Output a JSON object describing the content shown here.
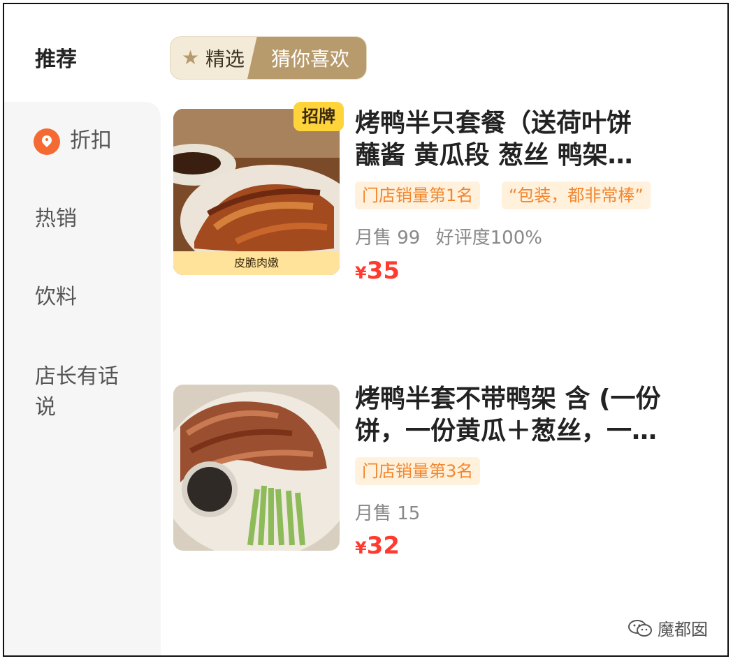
{
  "sidebar": {
    "items": [
      {
        "label": "推荐",
        "active": true,
        "icon": null
      },
      {
        "label": "折扣",
        "active": false,
        "icon": "discount-tag-icon"
      },
      {
        "label": "热销",
        "active": false,
        "icon": null
      },
      {
        "label": "饮料",
        "active": false,
        "icon": null
      },
      {
        "label": "店长有话说",
        "active": false,
        "icon": null
      }
    ]
  },
  "filter": {
    "left_label": "精选",
    "right_label": "猜你喜欢",
    "left_icon": "star-icon"
  },
  "dishes": [
    {
      "tag": "招牌",
      "thumb_caption": "皮脆肉嫩",
      "title_line1": "烤鸭半只套餐（送荷叶饼",
      "title_line2": "蘸酱 黄瓜段 葱丝 鸭架…",
      "badges": [
        "门店销量第1名",
        "“包装，都非常棒”"
      ],
      "sales": "月售 99",
      "rating": "好评度100%",
      "currency": "¥",
      "price": "35"
    },
    {
      "tag": "",
      "thumb_caption": "",
      "title_line1": "烤鸭半套不带鸭架 含 (一份",
      "title_line2": "饼，一份黄瓜＋葱丝，一…",
      "badges": [
        "门店销量第3名"
      ],
      "sales": "月售 15",
      "rating": "",
      "currency": "¥",
      "price": "32"
    }
  ],
  "watermark": {
    "label": "魔都囡",
    "icon": "wechat-icon"
  },
  "colors": {
    "accent_red": "#ff3b30",
    "badge_orange": "#f2862f",
    "gold": "#b89b6d",
    "signature_yellow": "#ffd43b"
  }
}
